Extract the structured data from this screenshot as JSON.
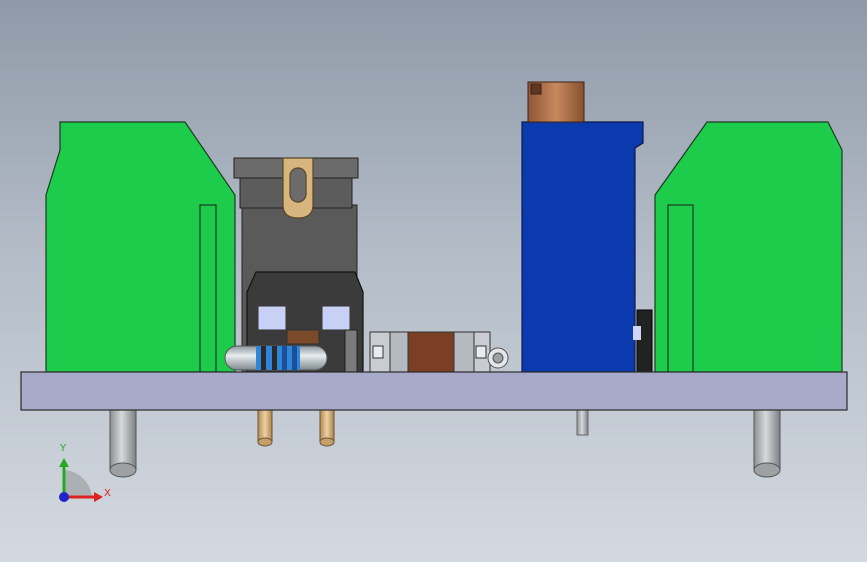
{
  "viewport": {
    "background_top": "#8f9aa8",
    "background_bottom": "#d3d9e0"
  },
  "colors": {
    "terminal_green": "#1ccc4a",
    "capacitor_blue": "#0a3aae",
    "copper": "#b0704a",
    "pcb_board": "#a7aac8",
    "regulator_gray": "#5a5a5a",
    "resistor_body": "#b9c3c8",
    "pin_gold": "#d9b47c",
    "pin_steel": "#b8bcbe"
  },
  "triad": {
    "y_label": "Y",
    "x_label": "X",
    "y_color": "#22aa22",
    "x_color": "#dd2222",
    "z_color": "#2222cc"
  }
}
